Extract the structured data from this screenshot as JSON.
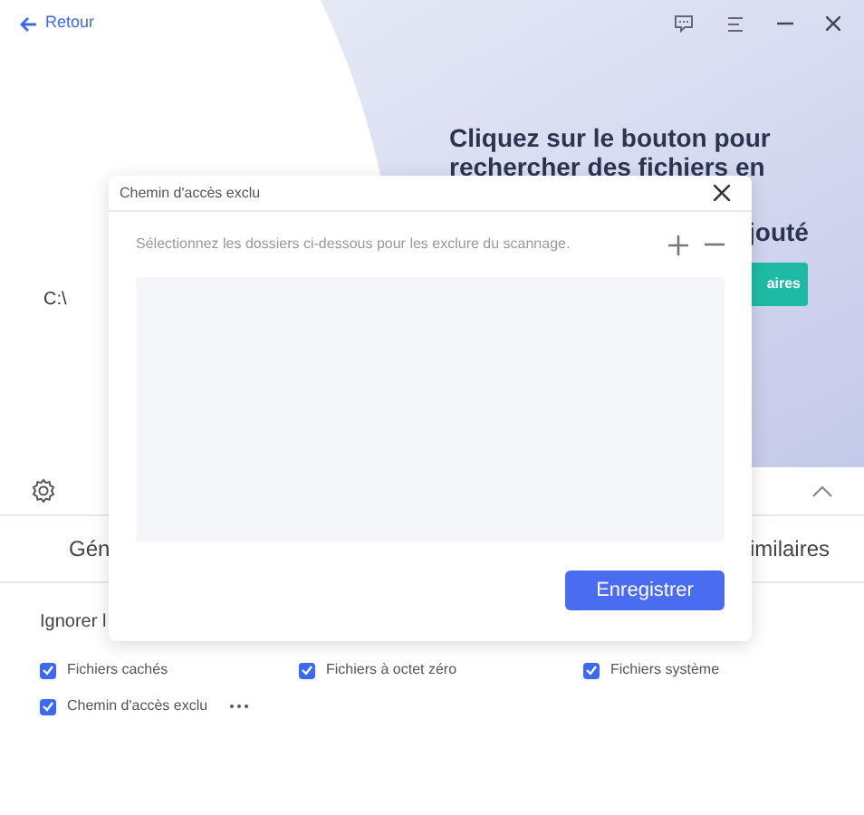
{
  "header": {
    "back_label": "Retour"
  },
  "drive": {
    "label": "C:\\"
  },
  "hero": {
    "lines": [
      "Cliquez sur le bouton pour",
      "rechercher des fichiers en"
    ],
    "partial_line": "jouté",
    "button_partial": "aires"
  },
  "tabs": [
    {
      "label": "Gén",
      "selected": false
    },
    {
      "label": "imilaires",
      "selected": false
    }
  ],
  "ignore_label": "Ignorer l",
  "options": [
    {
      "label": "Fichiers cachés",
      "checked": true,
      "more": false
    },
    {
      "label": "Fichiers à octet zéro",
      "checked": true,
      "more": false
    },
    {
      "label": "Fichiers système",
      "checked": true,
      "more": false
    },
    {
      "label": "Chemin d'accès exclu",
      "checked": true,
      "more": true
    }
  ],
  "dialog": {
    "title": "Chemin d'accès exclu",
    "description": "Sélectionnez les dossiers ci-dessous pour les exclure du scannage.",
    "save_button": "Enregistrer"
  }
}
